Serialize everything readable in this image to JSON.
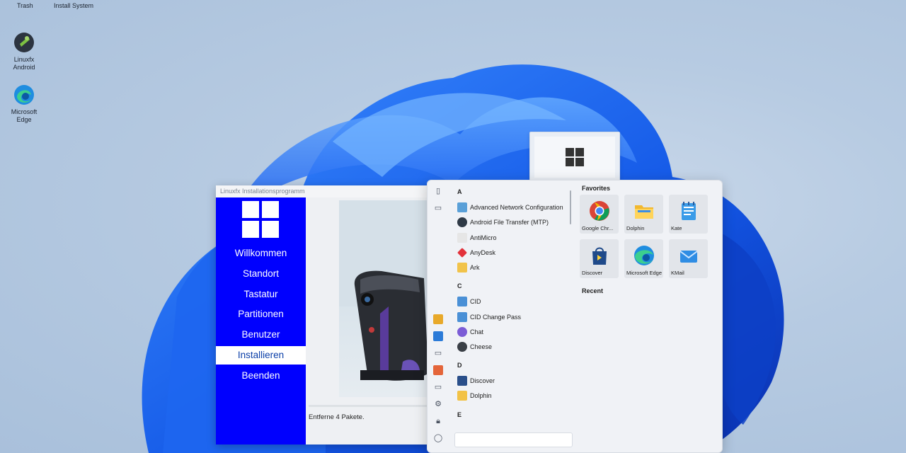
{
  "desktop": {
    "top_labels": [
      "Trash",
      "Install System"
    ],
    "icons": [
      {
        "label": "Linuxfx\nAndroid",
        "icon": "android-icon"
      },
      {
        "label": "Microsoft\nEdge",
        "icon": "edge-icon"
      }
    ]
  },
  "installer": {
    "title": "Linuxfx Installationsprogramm",
    "nav": [
      "Willkommen",
      "Standort",
      "Tastatur",
      "Partitionen",
      "Benutzer",
      "Installieren",
      "Beenden"
    ],
    "active": "Installieren",
    "status": "Entferne 4 Pakete.",
    "accent": "#0000fe"
  },
  "startmenu": {
    "sections": [
      {
        "letter": "A",
        "apps": [
          "Advanced Network Configuration",
          "Android File Transfer (MTP)",
          "AntiMicro",
          "AnyDesk",
          "Ark"
        ]
      },
      {
        "letter": "C",
        "apps": [
          "CID",
          "CID Change Pass",
          "Chat",
          "Cheese"
        ]
      },
      {
        "letter": "D",
        "apps": [
          "Discover",
          "Dolphin"
        ]
      },
      {
        "letter": "E",
        "apps": []
      }
    ],
    "favorites_title": "Favorites",
    "recent_title": "Recent",
    "favorites": [
      {
        "label": "Google Chr...",
        "icon": "chrome-icon"
      },
      {
        "label": "Dolphin",
        "icon": "folder-icon"
      },
      {
        "label": "Kate",
        "icon": "notepad-icon"
      },
      {
        "label": "Discover",
        "icon": "store-bag-icon"
      },
      {
        "label": "Microsoft Edge",
        "icon": "edge-icon"
      },
      {
        "label": "KMail",
        "icon": "mail-icon"
      }
    ],
    "search_placeholder": ""
  }
}
